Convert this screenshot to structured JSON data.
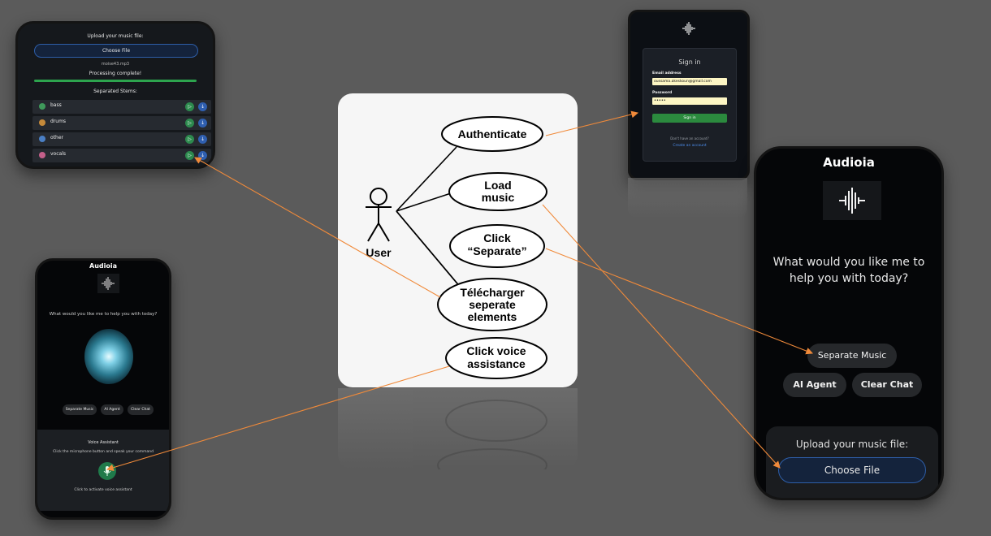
{
  "diagram": {
    "actor": "User",
    "use_cases": [
      {
        "lines": [
          "Authenticate"
        ]
      },
      {
        "lines": [
          "Load",
          "music"
        ]
      },
      {
        "lines": [
          "Click",
          "“Separate”"
        ]
      },
      {
        "lines": [
          "Télécharger",
          "seperate",
          "elements"
        ]
      },
      {
        "lines": [
          "Click voice",
          "assistance"
        ]
      }
    ]
  },
  "stems_screen": {
    "upload_label": "Upload your music file:",
    "choose_file": "Choose File",
    "filename": "moise43.mp3",
    "status": "Processing complete!",
    "stems_title": "Separated Stems:",
    "stems": [
      "bass",
      "drums",
      "other",
      "vocals"
    ],
    "play_glyph": "▷",
    "download_glyph": "↓"
  },
  "login_screen": {
    "title": "Sign in",
    "email_label": "Email address",
    "email_value": "oussama.akeskoun@gmail.com",
    "password_label": "Password",
    "password_value": "•••••",
    "sign_in_button": "Sign in",
    "no_account": "Don't have an account?",
    "create_account": "Create an account"
  },
  "voice_screen": {
    "title": "Audioia",
    "prompt": "What would you like me to help you with today?",
    "buttons": [
      "Separate Music",
      "AI Agent",
      "Clear Chat"
    ],
    "voice_title": "Voice Assistant",
    "voice_hint": "Click the microphone button and speak your command",
    "activate": "Click to activate voice assistant"
  },
  "home_screen": {
    "title": "Audioia",
    "prompt": "What would you like me to help you with today?",
    "separate": "Separate Music",
    "ai_agent": "AI Agent",
    "clear_chat": "Clear Chat",
    "upload_label": "Upload your music file:",
    "choose_file": "Choose File"
  },
  "colors": {
    "arrow": "#f08a3a",
    "accent_green": "#2da44e",
    "file_button": "#14233c",
    "file_border": "#2e5ea8"
  }
}
